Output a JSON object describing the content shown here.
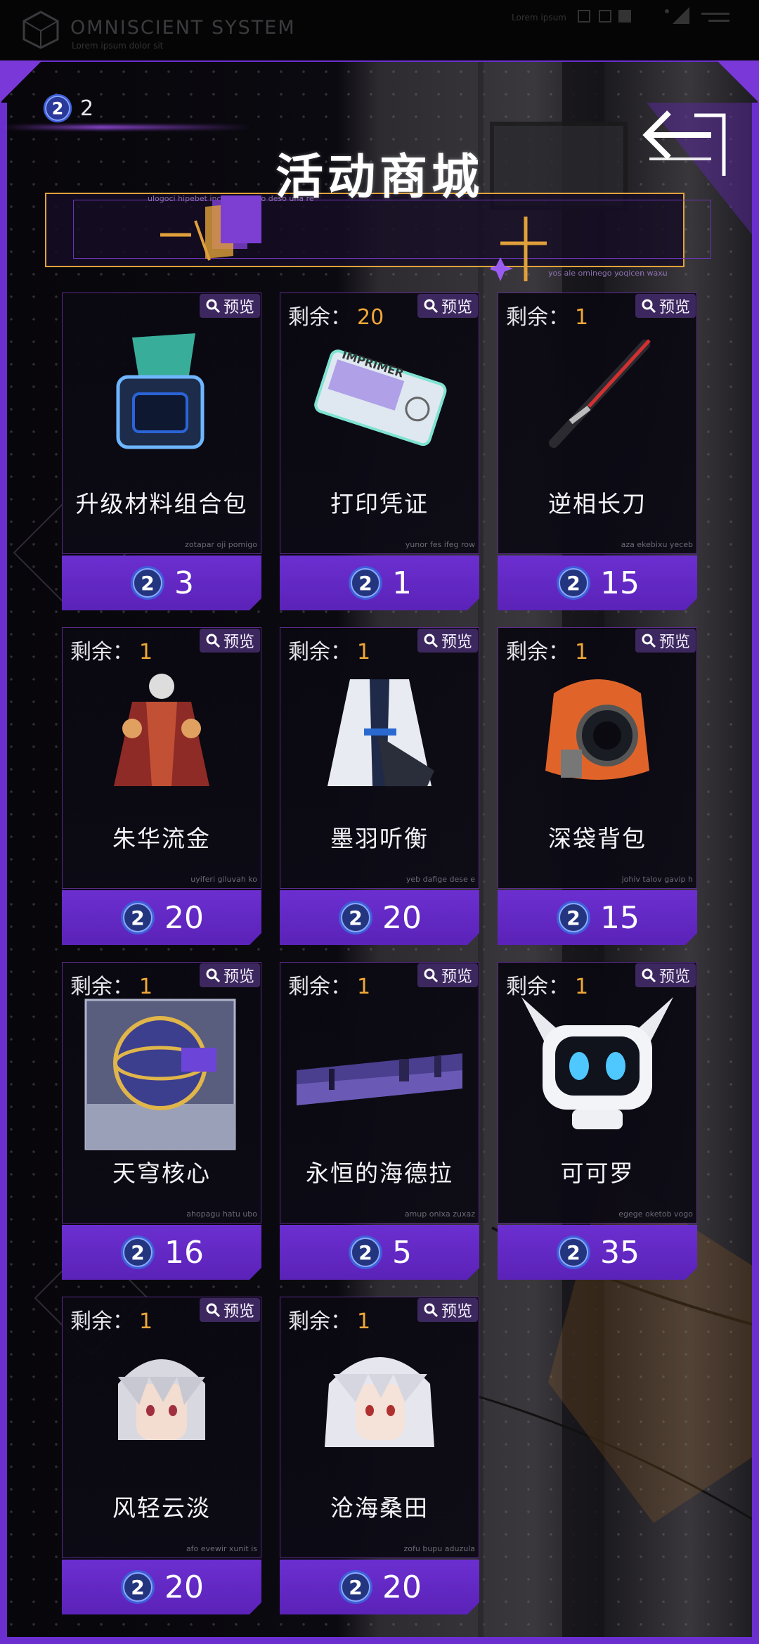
{
  "system": {
    "title": "OMNISCIENT  SYSTEM",
    "subtitle": "Lorem ipsum dolor sit",
    "right_text": "Lorem ipsum"
  },
  "currency": {
    "balance": "2",
    "icon": "purple-coin-icon"
  },
  "banner": {
    "title": "活动商城",
    "tiny_top": "ulogoci hipebet inchem iakevo deso una re",
    "tiny_bottom": "yos ale ominego yoqicen waxu"
  },
  "labels": {
    "remain": "剩余：",
    "preview": "预览"
  },
  "items": [
    {
      "name": "升级材料组合包",
      "remain": "",
      "price": "3",
      "tiny": "zotapar oji pomigo",
      "icon": "upgrade-box-icon"
    },
    {
      "name": "打印凭证",
      "remain": "20",
      "price": "1",
      "tiny": "yunor fes ifeg row",
      "icon": "print-ticket-icon"
    },
    {
      "name": "逆相长刀",
      "remain": "1",
      "price": "15",
      "tiny": "aza ekebixu yeceb",
      "icon": "blade-icon"
    },
    {
      "name": "朱华流金",
      "remain": "1",
      "price": "20",
      "tiny": "uyiferi giluvah ko",
      "icon": "red-outfit-icon"
    },
    {
      "name": "墨羽听衡",
      "remain": "1",
      "price": "20",
      "tiny": "yeb dafige dese e",
      "icon": "white-outfit-icon"
    },
    {
      "name": "深袋背包",
      "remain": "1",
      "price": "15",
      "tiny": "johiv talov gavip h",
      "icon": "backpack-icon"
    },
    {
      "name": "天穹核心",
      "remain": "1",
      "price": "16",
      "tiny": "ahopagu hatu ubo",
      "icon": "core-sphere-icon"
    },
    {
      "name": "永恒的海德拉",
      "remain": "1",
      "price": "5",
      "tiny": "amup onixa zuxaz",
      "icon": "city-banner-icon"
    },
    {
      "name": "可可罗",
      "remain": "1",
      "price": "35",
      "tiny": "egege oketob vogo",
      "icon": "robot-icon"
    },
    {
      "name": "风轻云淡",
      "remain": "1",
      "price": "20",
      "tiny": "afo evewir xunit is",
      "icon": "white-hair-boy-icon"
    },
    {
      "name": "沧海桑田",
      "remain": "1",
      "price": "20",
      "tiny": "zofu bupu aduzula",
      "icon": "white-hair-girl-icon"
    }
  ],
  "colors": {
    "accent": "#6b2fd0",
    "gold": "#f0a838",
    "frame": "#5b2b8d"
  }
}
